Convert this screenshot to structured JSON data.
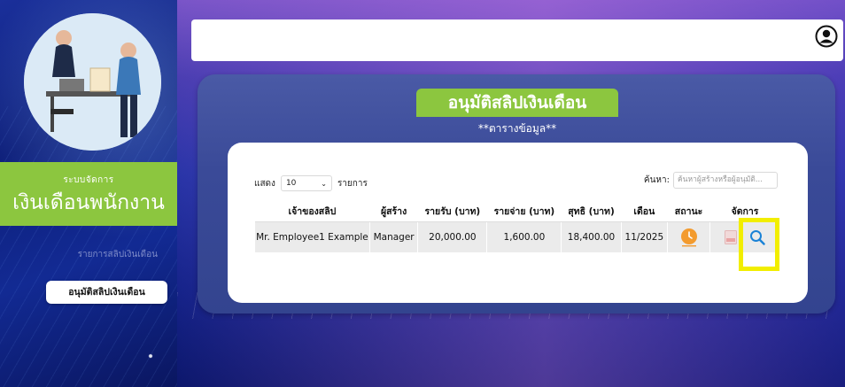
{
  "sidebar": {
    "brand_small": "ระบบจัดการ",
    "brand_big": "เงินเดือนพนักงาน",
    "menu_item_1": "รายการสลิปเงินเดือน",
    "menu_item_2": "อนุมัติสลิปเงินเดือน"
  },
  "panel": {
    "title": "อนุมัติสลิปเงินเดือน",
    "subtitle": "**ตารางข้อมูล**"
  },
  "controls": {
    "show_label": "แสดง",
    "page_size": "10",
    "items_label": "รายการ",
    "search_label": "ค้นหา:",
    "search_placeholder": "ค้นหาผู้สร้างหรือผู้อนุมัติ..."
  },
  "table": {
    "headers": [
      "เจ้าของสลิป",
      "ผู้สร้าง",
      "รายรับ (บาท)",
      "รายจ่าย (บาท)",
      "สุทธิ (บาท)",
      "เดือน",
      "สถานะ",
      "จัดการ"
    ],
    "rows": [
      {
        "owner": "Mr. Employee1 Example",
        "creator": "Manager",
        "income": "20,000.00",
        "expense": "1,600.00",
        "net": "18,400.00",
        "month": "11/2025",
        "status_icon": "clock-icon",
        "actions": [
          "pdf-icon",
          "search-icon"
        ]
      }
    ]
  },
  "colors": {
    "brand_green": "#8cc63f",
    "highlight": "#f2ee00",
    "status_orange": "#f39b2e",
    "action_blue": "#1a82d6"
  }
}
